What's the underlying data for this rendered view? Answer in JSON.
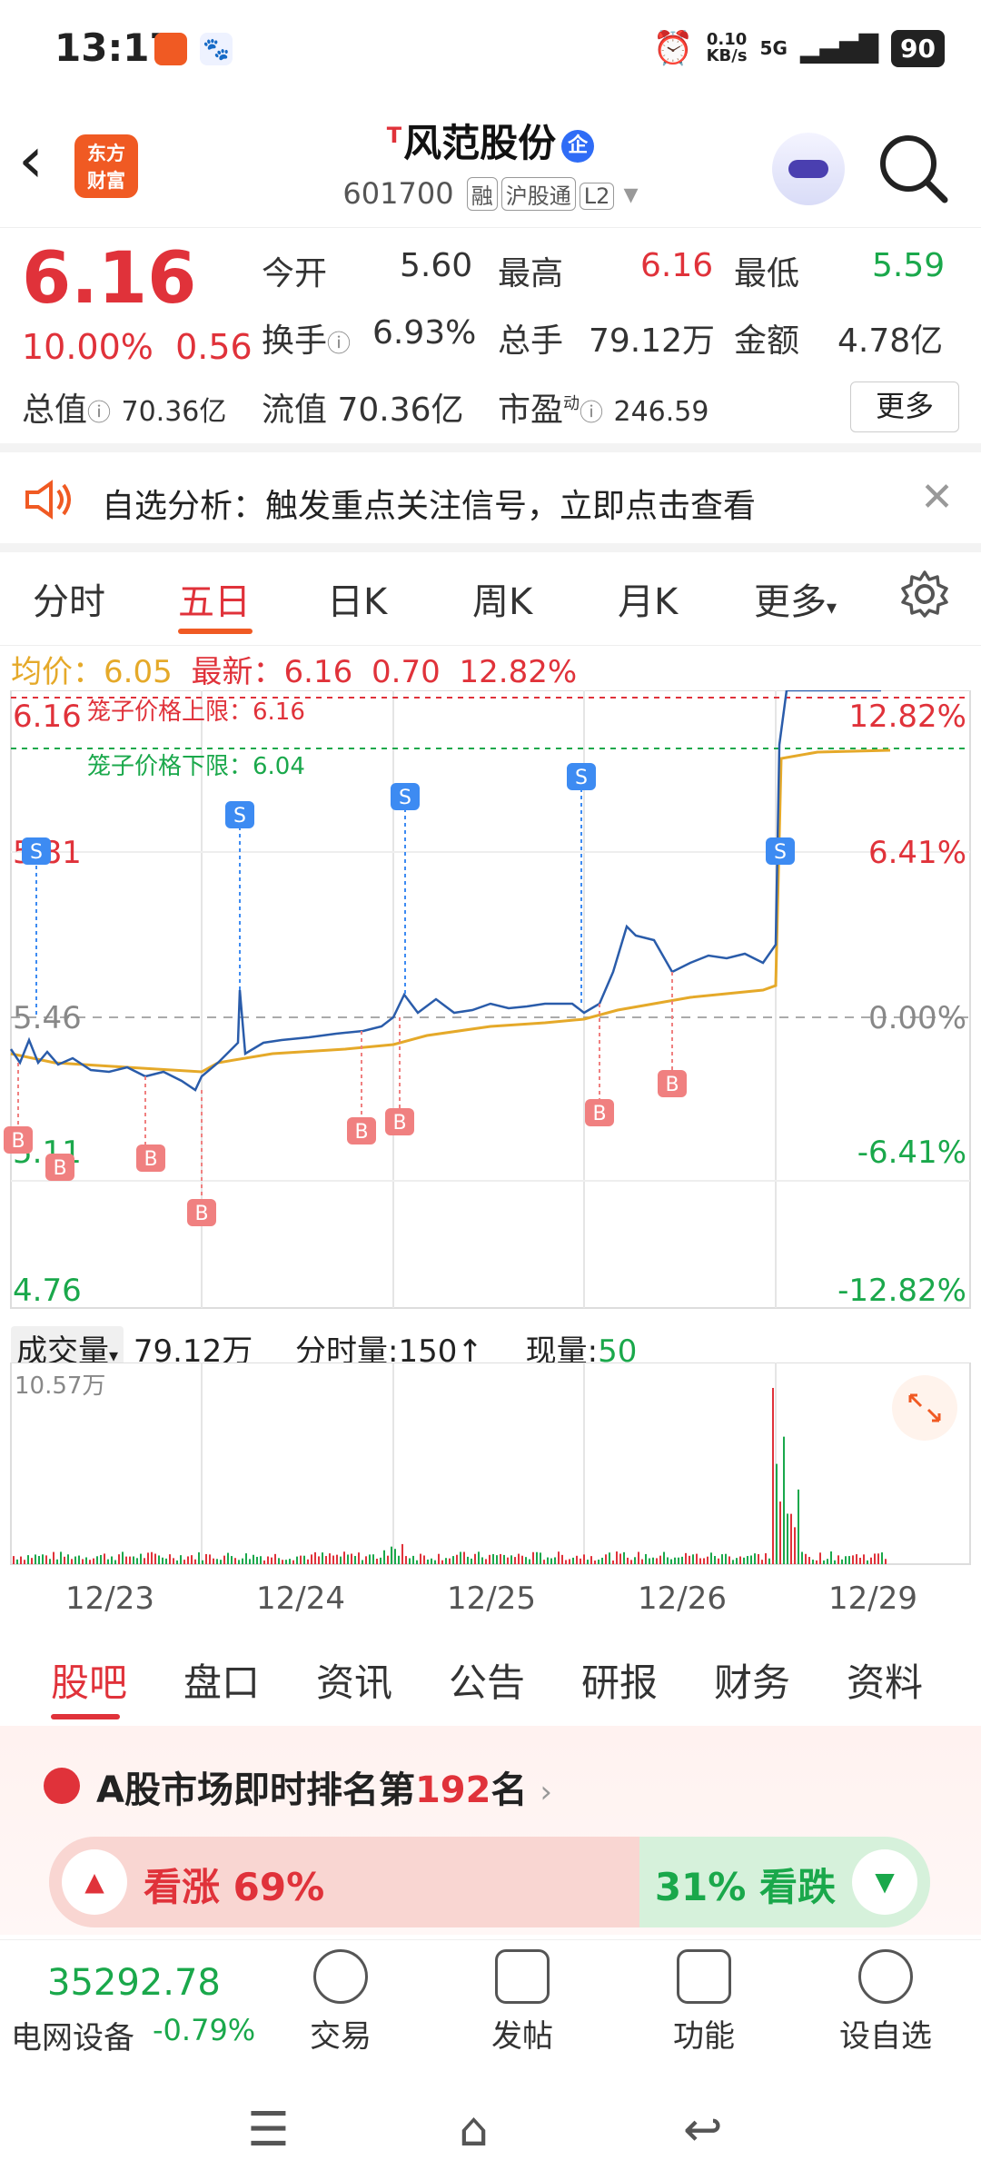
{
  "status_bar": {
    "time": "13:17",
    "speed": "0.10",
    "speed_unit": "KB/s",
    "network": "5G",
    "battery": "90"
  },
  "header": {
    "logo_line1": "东方",
    "logo_line2": "财富",
    "title_prefix": "T",
    "title": "风范股份",
    "title_badge": "企",
    "code": "601700",
    "tags": [
      "融",
      "沪股通",
      "L2"
    ]
  },
  "quote": {
    "price": "6.16",
    "change_pct": "10.00%",
    "change_amt": "0.56",
    "rows": [
      [
        {
          "label": "今开",
          "value": "5.60",
          "color": "#333333"
        },
        {
          "label": "最高",
          "value": "6.16",
          "color": "#e0323a"
        },
        {
          "label": "最低",
          "value": "5.59",
          "color": "#1aa84b"
        }
      ],
      [
        {
          "label": "换手",
          "value": "6.93%",
          "color": "#333333"
        },
        {
          "label": "总手",
          "value": "79.12万",
          "color": "#333333"
        },
        {
          "label": "金额",
          "value": "4.78亿",
          "color": "#333333"
        }
      ],
      [
        {
          "label": "总值",
          "value": "70.36亿",
          "color": "#333333"
        },
        {
          "label": "流值",
          "value": "70.36亿",
          "color": "#333333"
        },
        {
          "label": "市盈",
          "value": "246.59",
          "color": "#333333",
          "sup": "动"
        }
      ]
    ],
    "more_label": "更多"
  },
  "alert": {
    "text": "自选分析：触发重点关注信号，立即点击查看"
  },
  "chart_tabs": [
    "分时",
    "五日",
    "日K",
    "周K",
    "月K",
    "更多"
  ],
  "active_chart_tab": 1,
  "chart_info": {
    "avg_label": "均价：",
    "avg_value": "6.05",
    "latest_label": "最新：",
    "latest_value": "6.16",
    "latest_change": "0.70",
    "latest_pct": "12.82%"
  },
  "cage": {
    "upper": "笼子价格上限：6.16",
    "lower": "笼子价格下限：6.04"
  },
  "chart_data": {
    "type": "line",
    "x": [
      "12/23",
      "12/24",
      "12/25",
      "12/26",
      "12/29"
    ],
    "series": [
      {
        "name": "最新",
        "color": "#2a5caa"
      },
      {
        "name": "均价",
        "color": "#e5a929"
      }
    ],
    "y_axis_left": [
      "6.16",
      "5.81",
      "5.46",
      "5.11",
      "4.76"
    ],
    "y_axis_right": [
      "12.82%",
      "6.41%",
      "0.00%",
      "-6.41%",
      "-12.82%"
    ],
    "ylim": [
      4.76,
      6.16
    ],
    "base_price": 5.46,
    "markers_sell": [
      "S",
      "S",
      "S",
      "S",
      "S"
    ],
    "markers_buy": [
      "B",
      "B",
      "B",
      "B",
      "B",
      "B",
      "B",
      "B"
    ]
  },
  "volume": {
    "label": "成交量",
    "total": "79.12万",
    "tick_label": "分时量:150↑",
    "now_label": "现量:",
    "now_value": "50",
    "max": "10.57万"
  },
  "bottom_tabs": [
    "股吧",
    "盘口",
    "资讯",
    "公告",
    "研报",
    "财务",
    "资料"
  ],
  "active_bottom_tab": 0,
  "ranking": {
    "prefix": "A股市场即时排名第",
    "rank": "192",
    "suffix": "名"
  },
  "sentiment": {
    "bull_label": "看涨",
    "bull_pct": "69%",
    "bear_pct": "31%",
    "bear_label": "看跌"
  },
  "bottom_bar": {
    "index_value": "35292.78",
    "index_name": "电网设备",
    "index_change": "-0.79%",
    "items": [
      "交易",
      "发帖",
      "功能",
      "设自选"
    ]
  },
  "colors": {
    "red": "#e0323a",
    "green": "#1aa84b",
    "gold": "#e5a929",
    "brand": "#f05a23"
  }
}
